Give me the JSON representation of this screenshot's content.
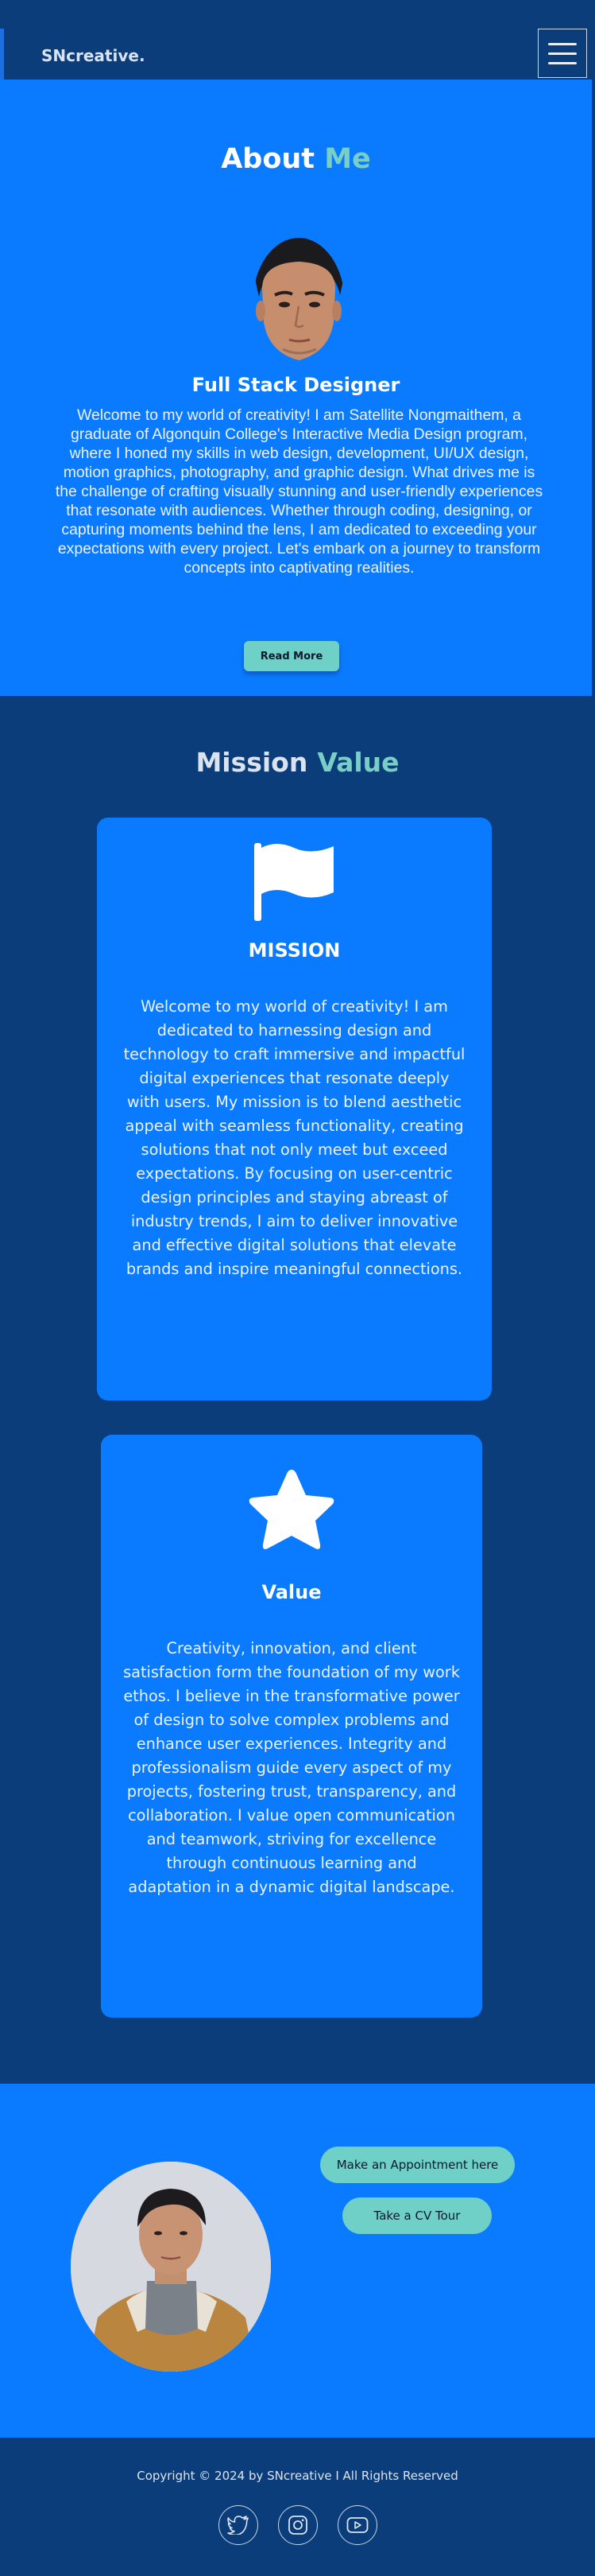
{
  "navbar": {
    "brand": "SNcreative.",
    "menu_icon": "hamburger-menu-icon"
  },
  "about": {
    "title_main": "About",
    "title_accent": "Me",
    "subtitle": "Full Stack Designer",
    "text": "Welcome to my world of creativity! I am Satellite Nongmaithem, a graduate of Algonquin College's Interactive Media Design program, where I honed my skills in web design, development, UI/UX design, motion graphics, photography, and graphic design. What drives me is the challenge of crafting visually stunning and user-friendly experiences that resonate with audiences. Whether through coding, designing, or capturing moments behind the lens, I am dedicated to exceeding your expectations with every project. Let's embark on a journey to transform concepts into captivating realities.",
    "read_more": "Read More"
  },
  "mission_value": {
    "title_main": "Mission",
    "title_accent": "Value",
    "mission": {
      "icon": "flag-icon",
      "heading": "MISSION",
      "text": "Welcome to my world of creativity! I am dedicated to harnessing design and technology to craft immersive and impactful digital experiences that resonate deeply with users. My mission is to blend aesthetic appeal with seamless functionality, creating solutions that not only meet but exceed expectations. By focusing on user-centric design principles and staying abreast of industry trends, I aim to deliver innovative and effective digital solutions that elevate brands and inspire meaningful connections."
    },
    "value": {
      "icon": "star-icon",
      "heading": "Value",
      "text": "Creativity, innovation, and client satisfaction form the foundation of my work ethos. I believe in the transformative power of design to solve complex problems and enhance user experiences. Integrity and professionalism guide every aspect of my projects, fostering trust, transparency, and collaboration. I value open communication and teamwork, striving for excellence through continuous learning and adaptation in a dynamic digital landscape."
    }
  },
  "cta": {
    "appointment": "Make an Appointment here",
    "cv_tour": "Take a  CV Tour"
  },
  "footer": {
    "copyright": "Copyright © 2024 by SNcreative I All Rights Reserved",
    "socials": [
      "twitter-icon",
      "instagram-icon",
      "youtube-icon"
    ]
  },
  "colors": {
    "primary_blue": "#0a7bff",
    "dark_blue": "#0a3d7a",
    "accent_teal": "#79cfc6",
    "button_teal": "#6fd0c8"
  }
}
